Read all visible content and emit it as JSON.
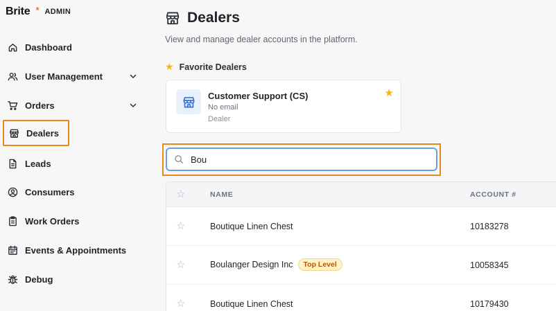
{
  "brand": {
    "name": "Brite",
    "star": "*",
    "role": "ADMIN"
  },
  "sidebar": {
    "items": [
      {
        "label": "Dashboard",
        "icon": "home-icon"
      },
      {
        "label": "User Management",
        "icon": "users-icon",
        "expandable": true
      },
      {
        "label": "Orders",
        "icon": "cart-icon",
        "expandable": true
      },
      {
        "label": "Dealers",
        "icon": "store-icon",
        "highlighted": true
      },
      {
        "label": "Leads",
        "icon": "document-icon"
      },
      {
        "label": "Consumers",
        "icon": "user-circle-icon"
      },
      {
        "label": "Work Orders",
        "icon": "clipboard-icon"
      },
      {
        "label": "Events & Appointments",
        "icon": "calendar-icon"
      },
      {
        "label": "Debug",
        "icon": "bug-icon"
      }
    ]
  },
  "page": {
    "title": "Dealers",
    "subtitle": "View and manage dealer accounts in the platform."
  },
  "favorites": {
    "title": "Favorite Dealers",
    "card": {
      "name": "Customer Support (CS)",
      "email": "No email",
      "role": "Dealer"
    }
  },
  "search": {
    "value": "Bou"
  },
  "table": {
    "columns": [
      "NAME",
      "ACCOUNT #"
    ],
    "rows": [
      {
        "name": "Boutique Linen Chest",
        "account": "10183278",
        "badge": ""
      },
      {
        "name": "Boulanger Design Inc",
        "account": "10058345",
        "badge": "Top Level"
      },
      {
        "name": "Boutique Linen Chest",
        "account": "10179430",
        "badge": ""
      }
    ]
  },
  "colors": {
    "highlight": "#e5891c",
    "star": "#f5b50a",
    "focus": "#6aa0e0",
    "badge_text": "#b45309"
  }
}
